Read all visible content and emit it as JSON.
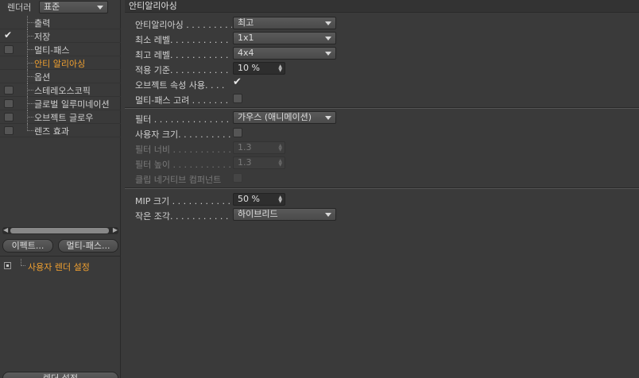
{
  "left": {
    "renderer_label": "렌더러",
    "renderer_value": "표준",
    "tree": [
      {
        "label": "출력",
        "checked": false,
        "has_box": false,
        "active": false
      },
      {
        "label": "저장",
        "checked": true,
        "has_box": false,
        "active": false
      },
      {
        "label": "멀티-패스",
        "checked": false,
        "has_box": true,
        "active": false
      },
      {
        "label": "안티 알리아싱",
        "checked": false,
        "has_box": false,
        "active": true
      },
      {
        "label": "옵션",
        "checked": false,
        "has_box": false,
        "active": false
      },
      {
        "label": "스테레오스코픽",
        "checked": false,
        "has_box": true,
        "active": false
      },
      {
        "label": "글로벌 일루미네이션",
        "checked": false,
        "has_box": true,
        "active": false
      },
      {
        "label": "오브젝트 글로우",
        "checked": false,
        "has_box": true,
        "active": false
      },
      {
        "label": "렌즈 효과",
        "checked": false,
        "has_box": true,
        "active": false
      }
    ],
    "effects_button": "이펙트...",
    "multipass_button": "멀티-패스...",
    "preset_label": "사용자 렌더 설정",
    "bottom_button": "렌더 설정"
  },
  "right": {
    "section_title": "안티알리아싱",
    "antialiasing": {
      "label": "안티알리아싱 . . . . . . . . .",
      "value": "최고"
    },
    "min_level": {
      "label": "최소 레벨. . . . . . . . . . . .",
      "value": "1x1"
    },
    "max_level": {
      "label": "최고 레벨. . . . . . . . . . . .",
      "value": "4x4"
    },
    "threshold": {
      "label": "적용 기준. . . . . . . . . . . .",
      "value": "10 %"
    },
    "use_object_props": {
      "label": "오브젝트 속성 사용. . . ."
    },
    "consider_multipass": {
      "label": "멀티-패스 고려 . . . . . . ."
    },
    "filter": {
      "label": "필터 . . . . . . . . . . . . . . . .",
      "value": "가우스 (애니메이션)"
    },
    "custom_size": {
      "label": "사용자 크기. . . . . . . . . ."
    },
    "filter_width": {
      "label": "필터 너비 . . . . . . . . . . .",
      "value": "1.3"
    },
    "filter_height": {
      "label": "필터 높이 . . . . . . . . . . .",
      "value": "1.3"
    },
    "clip_negative": {
      "label": "클립 네거티브 컴퍼넌트"
    },
    "mip_scale": {
      "label": "MIP 크기 . . . . . . . . . . . .",
      "value": "50 %"
    },
    "micropolygons": {
      "label": "작은 조각. . . . . . . . . . . .",
      "value": "하이브리드"
    }
  }
}
